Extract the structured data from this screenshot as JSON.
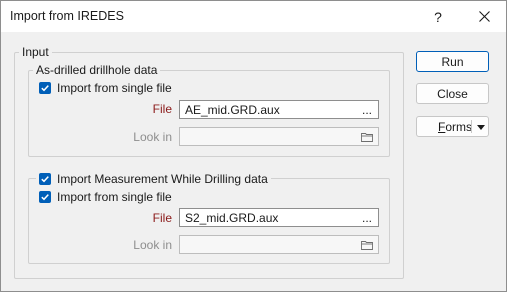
{
  "window": {
    "title": "Import from IREDES",
    "help_label": "?",
    "close_icon": "close-icon"
  },
  "input_group": {
    "legend": "Input"
  },
  "as_drilled": {
    "legend": "As-drilled drillhole data",
    "single_file_label": "Import from single file",
    "single_file_checked": true,
    "file_label": "File",
    "file_value": "AE_mid.GRD.aux",
    "file_browse": "...",
    "lookin_label": "Look in",
    "lookin_value": "",
    "lookin_icon": "folder-icon"
  },
  "mwd": {
    "import_label": "Import Measurement While Drilling data",
    "import_checked": true,
    "single_file_label": "Import from single file",
    "single_file_checked": true,
    "file_label": "File",
    "file_value": "S2_mid.GRD.aux",
    "file_browse": "...",
    "lookin_label": "Look in",
    "lookin_value": "",
    "lookin_icon": "folder-icon"
  },
  "buttons": {
    "run": "Run",
    "close": "Close",
    "forms_mnemonic": "F",
    "forms_rest": "orms",
    "forms_arrow": "chevron-down-icon"
  },
  "colors": {
    "accent": "#005fb8",
    "required_label": "#8b1a1a",
    "disabled_label": "#8e8e8e",
    "dialog_bg": "#f0f0f0"
  }
}
